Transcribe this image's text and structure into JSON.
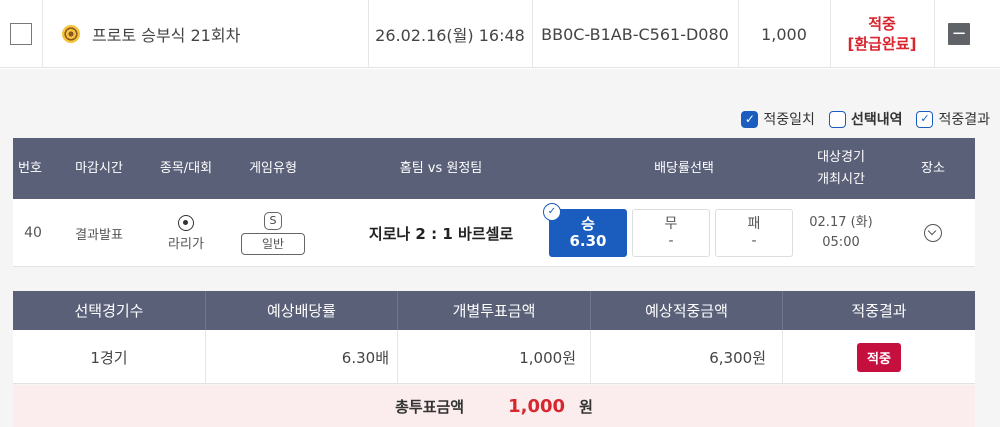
{
  "ticket": {
    "name": "프로토 승부식 21회차",
    "datetime": "26.02.16(월) 16:48",
    "code": "BB0C-B1AB-C561-D080",
    "amount": "1,000",
    "status_line1": "적중",
    "status_line2": "[환급완료]",
    "collapse_label": "−"
  },
  "filters": [
    {
      "label": "적중일치",
      "state": "checked"
    },
    {
      "label": "선택내역",
      "state": "unchecked"
    },
    {
      "label": "적중결과",
      "state": "outline-checked"
    }
  ],
  "game_table": {
    "headers": {
      "no": "번호",
      "deadline": "마감시간",
      "sport": "종목/대회",
      "game_type": "게임유형",
      "teams": "홈팀 vs 원정팀",
      "odds": "배당률선택",
      "match_time_line1": "대상경기",
      "match_time_line2": "개최시간",
      "venue": "장소"
    },
    "rows": [
      {
        "no": "40",
        "deadline": "결과발표",
        "league": "라리가",
        "type_badge": "S",
        "type": "일반",
        "match": "지로나 2 : 1 바르셀로",
        "odds": [
          {
            "label": "승",
            "value": "6.30",
            "selected": true
          },
          {
            "label": "무",
            "value": "-",
            "selected": false
          },
          {
            "label": "패",
            "value": "-",
            "selected": false
          }
        ],
        "date": "02.17 (화)",
        "time": "05:00"
      }
    ]
  },
  "summary": {
    "headers": [
      "선택경기수",
      "예상배당률",
      "개별투표금액",
      "예상적중금액",
      "적중결과"
    ],
    "row": {
      "games": "1경기",
      "expected_odds": "6.30배",
      "bet_amount": "1,000원",
      "expected_win": "6,300원",
      "result": "적중"
    }
  },
  "total": {
    "label": "총투표금액",
    "value": "1,000",
    "unit": "원"
  },
  "colors": {
    "accent": "#1b5dbf",
    "header_bg": "#5a6078",
    "hit_red": "#d8262f",
    "hit_badge": "#c5103f"
  }
}
